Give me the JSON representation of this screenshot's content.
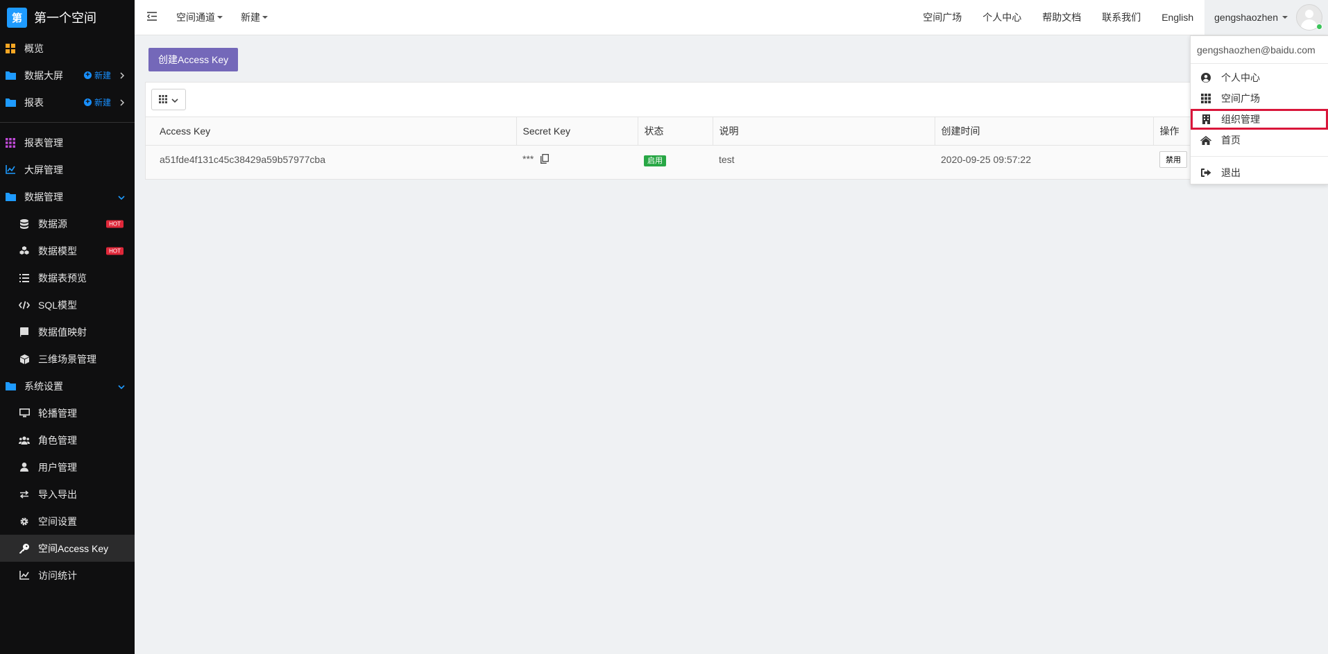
{
  "brand": {
    "logo": "第",
    "name": "第一个空间"
  },
  "sidebar": {
    "items": [
      {
        "label": "概览",
        "icon": "dashboard-grid-icon"
      },
      {
        "label": "数据大屏",
        "icon": "folder-icon",
        "new": "新建"
      },
      {
        "label": "报表",
        "icon": "folder-icon",
        "new": "新建"
      },
      {
        "label": "报表管理",
        "icon": "apps-grid-icon"
      },
      {
        "label": "大屏管理",
        "icon": "line-chart-icon"
      },
      {
        "label": "数据管理",
        "icon": "folder-icon"
      },
      {
        "label": "数据源",
        "icon": "database-icon",
        "badge": "HOT"
      },
      {
        "label": "数据模型",
        "icon": "cubes-icon",
        "badge": "HOT"
      },
      {
        "label": "数据表预览",
        "icon": "list-icon"
      },
      {
        "label": "SQL模型",
        "icon": "code-icon"
      },
      {
        "label": "数据值映射",
        "icon": "book-icon"
      },
      {
        "label": "三维场景管理",
        "icon": "cube-icon"
      },
      {
        "label": "系统设置",
        "icon": "folder-icon"
      },
      {
        "label": "轮播管理",
        "icon": "monitor-icon"
      },
      {
        "label": "角色管理",
        "icon": "users-icon"
      },
      {
        "label": "用户管理",
        "icon": "user-icon"
      },
      {
        "label": "导入导出",
        "icon": "exchange-icon"
      },
      {
        "label": "空间设置",
        "icon": "gear-icon"
      },
      {
        "label": "空间Access Key",
        "icon": "key-icon"
      },
      {
        "label": "访问统计",
        "icon": "line-chart-icon"
      }
    ]
  },
  "topbar": {
    "links_left": [
      "空间通道",
      "新建"
    ],
    "links_right": [
      "空间广场",
      "个人中心",
      "帮助文档",
      "联系我们",
      "English"
    ],
    "username": "gengshaozhen"
  },
  "main": {
    "create_label": "创建Access Key",
    "table": {
      "headers": [
        "Access Key",
        "Secret Key",
        "状态",
        "说明",
        "创建时间",
        "操作"
      ],
      "rows": [
        {
          "access_key": "a51fde4f131c45c38429a59b57977cba",
          "secret": "***",
          "status": "启用",
          "desc": "test",
          "created": "2020-09-25 09:57:22",
          "op": "禁用"
        }
      ]
    }
  },
  "dropdown": {
    "email": "gengshaozhen@baidu.com",
    "items": [
      {
        "label": "个人中心",
        "icon": "user-circle-icon"
      },
      {
        "label": "空间广场",
        "icon": "apps-grid-icon"
      },
      {
        "label": "组织管理",
        "icon": "building-icon"
      },
      {
        "label": "首页",
        "icon": "home-icon"
      },
      {
        "label": "退出",
        "icon": "sign-out-icon"
      }
    ]
  },
  "colors": {
    "accent": "#7468b9",
    "sidebar_bg": "#0f0f10",
    "link_blue": "#1890ff",
    "hot": "#e0283a",
    "success": "#28a745",
    "highlight": "#d9163a"
  }
}
